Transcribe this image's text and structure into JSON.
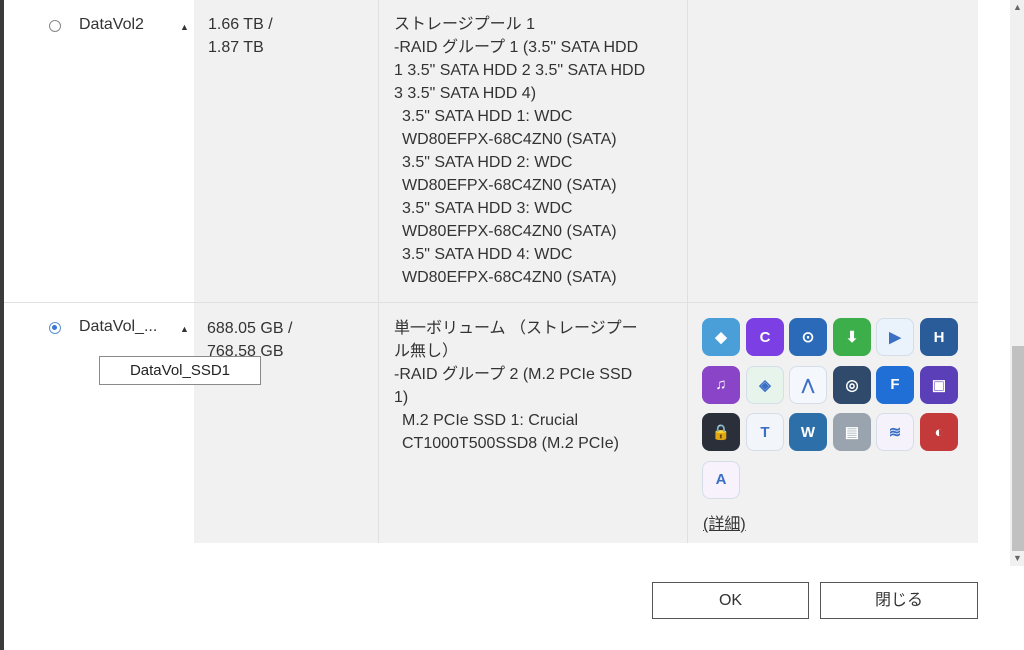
{
  "rows": [
    {
      "name": "DataVol2",
      "capacity_used": "1.66 TB /",
      "capacity_total": "1.87 TB",
      "pool_lines": [
        "ストレージプール 1",
        "-RAID グループ 1 (3.5\" SATA HDD",
        "1 3.5\" SATA HDD 2 3.5\" SATA HDD",
        "3 3.5\" SATA HDD 4)",
        "3.5\" SATA HDD 1: WDC",
        "WD80EFPX-68C4ZN0 (SATA)",
        "3.5\" SATA HDD 2: WDC",
        "WD80EFPX-68C4ZN0 (SATA)",
        "3.5\" SATA HDD 3: WDC",
        "WD80EFPX-68C4ZN0 (SATA)",
        "3.5\" SATA HDD 4: WDC",
        "WD80EFPX-68C4ZN0 (SATA)"
      ]
    },
    {
      "name": "DataVol_...",
      "capacity_used": "688.05 GB /",
      "capacity_total": "768.58 GB",
      "pool_lines": [
        "単一ボリューム （ストレージプー",
        "ル無し）",
        "-RAID グループ 2 (M.2 PCIe SSD",
        "1)",
        "M.2 PCIe SSD 1: Crucial",
        "CT1000T500SSD8 (M.2 PCIe)"
      ],
      "tooltip": "DataVol_SSD1",
      "apps": [
        {
          "icon": "container-station-icon",
          "color": "#4a9fd8",
          "glyph": "◆"
        },
        {
          "icon": "video-station-icon",
          "color": "#7b3fe4",
          "glyph": "C"
        },
        {
          "icon": "hybrid-backup-link-icon",
          "color": "#2a6ab8",
          "glyph": "⊙"
        },
        {
          "icon": "download-station-icon",
          "color": "#3cae4a",
          "glyph": "⬇"
        },
        {
          "icon": "qsync-icon",
          "color": "#eaf2fb",
          "glyph": "▶"
        },
        {
          "icon": "hbs-icon",
          "color": "#2a5c9a",
          "glyph": "H"
        },
        {
          "icon": "music-station-icon",
          "color": "#8a44c8",
          "glyph": "♫"
        },
        {
          "icon": "virtualization-station-icon",
          "color": "#e6f4ec",
          "glyph": "◈"
        },
        {
          "icon": "antenna-app-icon",
          "color": "#f4f7fb",
          "glyph": "⋀"
        },
        {
          "icon": "qsirch-icon",
          "color": "#2f4a6a",
          "glyph": "◎"
        },
        {
          "icon": "file-station-icon",
          "color": "#1f6fd6",
          "glyph": "F"
        },
        {
          "icon": "cube-app-icon",
          "color": "#5a3fb8",
          "glyph": "▣"
        },
        {
          "icon": "qvpn-icon",
          "color": "#2a2f3a",
          "glyph": "🔒"
        },
        {
          "icon": "text-editor-icon",
          "color": "#f2f6fb",
          "glyph": "T"
        },
        {
          "icon": "wordpress-icon",
          "color": "#2d6fa8",
          "glyph": "W"
        },
        {
          "icon": "web-app-icon",
          "color": "#9aa4ae",
          "glyph": "▤"
        },
        {
          "icon": "qumagie-icon",
          "color": "#f6f2fb",
          "glyph": "≋"
        },
        {
          "icon": "malware-remover-icon",
          "color": "#c43a3a",
          "glyph": "◐"
        },
        {
          "icon": "ai-core-icon",
          "color": "#f7f2fb",
          "glyph": "A"
        }
      ],
      "details_link": "(詳細)"
    }
  ],
  "buttons": {
    "ok": "OK",
    "close": "閉じる"
  }
}
